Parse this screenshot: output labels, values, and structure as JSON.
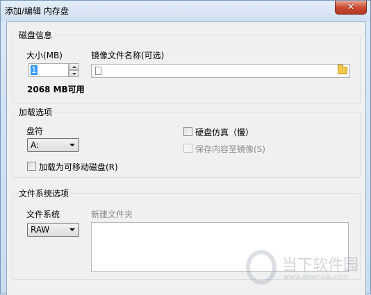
{
  "window": {
    "title": "添加/编辑 内存盘",
    "close_glyph": "✕"
  },
  "disk_info": {
    "group_title": "磁盘信息",
    "size_label": "大小(MB)",
    "size_value": "1",
    "free_text": "2068 MB可用",
    "image_label": "镜像文件名称(可选)",
    "image_value": "",
    "file_icon": "file-icon",
    "browse_icon": "folder-icon"
  },
  "mount_options": {
    "group_title": "加载选项",
    "drive_label": "盘符",
    "drive_value": "A:",
    "removable_label": "加载为可移动磁盘(R)",
    "removable_checked": false,
    "hdd_emulate_label": "硬盘仿真（慢）",
    "hdd_emulate_checked": false,
    "save_to_image_label": "保存内容至镜像(S)",
    "save_to_image_checked": false,
    "save_to_image_enabled": false
  },
  "fs_options": {
    "group_title": "文件系统选项",
    "fs_label": "文件系统",
    "fs_value": "RAW",
    "new_folder_label": "新建文件夹",
    "new_folder_enabled": false
  },
  "watermark": {
    "brand": "当下软件园",
    "url": "www.downxia.com"
  }
}
